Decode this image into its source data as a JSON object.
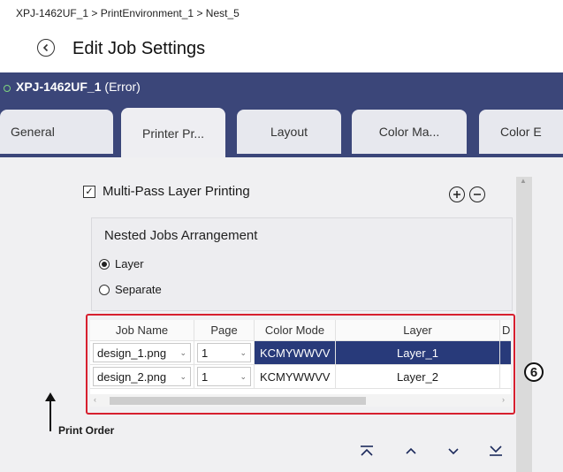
{
  "breadcrumb": "XPJ-1462UF_1 > PrintEnvironment_1 > Nest_5",
  "header": {
    "title": "Edit Job Settings"
  },
  "device": {
    "name": "XPJ-1462UF_1",
    "status": "(Error)"
  },
  "tabs": [
    {
      "label": "General"
    },
    {
      "label": "Printer Pr..."
    },
    {
      "label": "Layout"
    },
    {
      "label": "Color Ma..."
    },
    {
      "label": "Color E"
    }
  ],
  "multipass": {
    "label": "Multi-Pass Layer Printing",
    "checked": true
  },
  "nested": {
    "title": "Nested Jobs Arrangement",
    "options": [
      {
        "label": "Layer",
        "selected": true
      },
      {
        "label": "Separate",
        "selected": false
      }
    ]
  },
  "table": {
    "columns": [
      "Job Name",
      "Page",
      "Color Mode",
      "Layer",
      "D"
    ],
    "rows": [
      {
        "job": "design_1.png",
        "page": "1",
        "color_mode": "KCMYWWVV",
        "layer": "Layer_1",
        "selected": true
      },
      {
        "job": "design_2.png",
        "page": "1",
        "color_mode": "KCMYWWVV",
        "layer": "Layer_2",
        "selected": false
      }
    ]
  },
  "callout": "6",
  "print_order_label": "Print Order",
  "colors": {
    "header_bg": "#3b4679",
    "highlight": "#283a7a",
    "callout_border": "#d7202f"
  }
}
